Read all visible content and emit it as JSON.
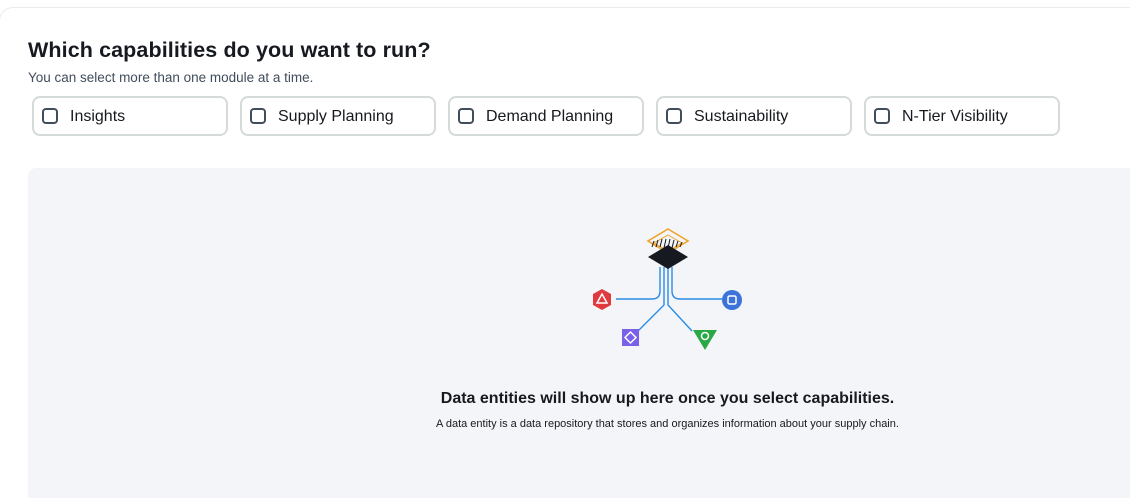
{
  "question": {
    "title": "Which capabilities do you want to run?",
    "subtitle": "You can select more than one module at a time."
  },
  "capabilities": [
    {
      "label": "Insights",
      "checked": false
    },
    {
      "label": "Supply Planning",
      "checked": false
    },
    {
      "label": "Demand Planning",
      "checked": false
    },
    {
      "label": "Sustainability",
      "checked": false
    },
    {
      "label": "N-Tier Visibility",
      "checked": false
    }
  ],
  "empty_state": {
    "title": "Data entities will show up here once you select capabilities.",
    "description": "A data entity is a data repository that stores and organizes information about your supply chain.",
    "icons": [
      "stack-icon",
      "warning-hexagon-icon",
      "square-circle-icon",
      "diamond-square-icon",
      "triangle-down-icon"
    ]
  },
  "colors": {
    "border": "#d5dbdb",
    "panel_bg": "#f4f5f8",
    "connector": "#2a8ce8",
    "red": "#e0393e",
    "blue": "#3b73d9",
    "purple": "#7b61e8",
    "green": "#29a845",
    "orange": "#f0a32a"
  }
}
